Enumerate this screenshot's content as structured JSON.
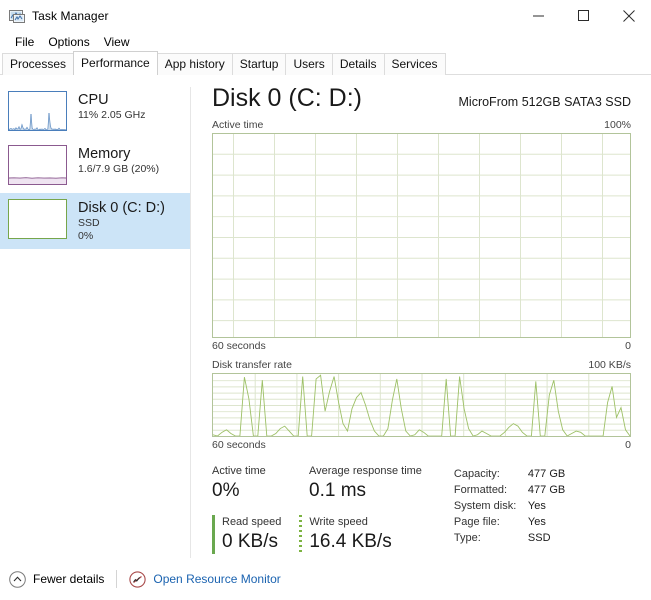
{
  "window": {
    "title": "Task Manager",
    "app_icon": "task-manager-icon",
    "controls": {
      "minimize": "minimize-icon",
      "maximize": "maximize-icon",
      "close": "close-icon"
    }
  },
  "menubar": {
    "items": [
      "File",
      "Options",
      "View"
    ]
  },
  "tabs": [
    {
      "label": "Processes",
      "active": false
    },
    {
      "label": "Performance",
      "active": true
    },
    {
      "label": "App history",
      "active": false
    },
    {
      "label": "Startup",
      "active": false
    },
    {
      "label": "Users",
      "active": false
    },
    {
      "label": "Details",
      "active": false
    },
    {
      "label": "Services",
      "active": false
    }
  ],
  "sidebar": {
    "items": [
      {
        "name": "CPU",
        "line1": "11%  2.05 GHz",
        "line2": "",
        "selected": false,
        "accent": "#4a7ebb",
        "fill": "#dce6f1"
      },
      {
        "name": "Memory",
        "line1": "1.6/7.9 GB (20%)",
        "line2": "",
        "selected": false,
        "accent": "#8b5a8f",
        "fill": "#f0e6f2"
      },
      {
        "name": "Disk 0 (C: D:)",
        "line1": "SSD",
        "line2": "0%",
        "selected": true,
        "accent": "#77a64b",
        "fill": "#ffffff"
      }
    ]
  },
  "main": {
    "title": "Disk 0 (C: D:)",
    "subtitle": "MicroFrom 512GB SATA3 SSD",
    "charts": [
      {
        "label": "Active time",
        "max_label": "100%",
        "left_foot": "60 seconds",
        "right_foot": "0"
      },
      {
        "label": "Disk transfer rate",
        "max_label": "100 KB/s",
        "left_foot": "60 seconds",
        "right_foot": "0"
      }
    ],
    "stats": {
      "active_time": {
        "label": "Active time",
        "value": "0%"
      },
      "avg_response": {
        "label": "Average response time",
        "value": "0.1 ms"
      },
      "read_speed": {
        "label": "Read speed",
        "value": "0 KB/s"
      },
      "write_speed": {
        "label": "Write speed",
        "value": "16.4 KB/s"
      },
      "details": [
        {
          "key": "Capacity:",
          "value": "477 GB"
        },
        {
          "key": "Formatted:",
          "value": "477 GB"
        },
        {
          "key": "System disk:",
          "value": "Yes"
        },
        {
          "key": "Page file:",
          "value": "Yes"
        },
        {
          "key": "Type:",
          "value": "SSD"
        }
      ]
    }
  },
  "footer": {
    "fewer_details": "Fewer details",
    "resource_monitor": "Open Resource Monitor"
  },
  "colors": {
    "chart_border": "#b2c49a",
    "chart_grid": "#d9e2c8",
    "chart_line": "#a8c97f",
    "selection": "#cce4f7",
    "link": "#1b63b0",
    "cpu_accent": "#4a7ebb",
    "memory_accent": "#8b5a8f",
    "disk_accent": "#77a64b"
  },
  "chart_data": {
    "type": "line",
    "title": "Disk transfer rate",
    "ylabel": "KB/s",
    "xlabel": "60 seconds",
    "ylim": [
      0,
      100
    ],
    "values": [
      2,
      0,
      6,
      10,
      4,
      0,
      0,
      95,
      60,
      0,
      0,
      90,
      0,
      0,
      4,
      12,
      16,
      8,
      0,
      0,
      96,
      0,
      0,
      92,
      98,
      40,
      72,
      96,
      55,
      20,
      8,
      44,
      62,
      70,
      50,
      26,
      8,
      0,
      0,
      12,
      58,
      92,
      44,
      8,
      0,
      2,
      10,
      6,
      0,
      0,
      0,
      0,
      92,
      0,
      0,
      96,
      44,
      12,
      0,
      2,
      8,
      4,
      0,
      0,
      0,
      6,
      14,
      20,
      16,
      6,
      0,
      0,
      88,
      0,
      0,
      66,
      90,
      40,
      10,
      0,
      4,
      8,
      6,
      0,
      0,
      0,
      0,
      0,
      54,
      80,
      30,
      46,
      10,
      0
    ]
  },
  "active_time_chart": {
    "type": "area",
    "title": "Active time",
    "ylim": [
      0,
      100
    ],
    "values": [
      0,
      0,
      0,
      0,
      0,
      0,
      0,
      0,
      0,
      0,
      0,
      0,
      0,
      0,
      0,
      0,
      0,
      0,
      0,
      0,
      0,
      0,
      0,
      0,
      0,
      0,
      0,
      0,
      0,
      0
    ]
  },
  "cpu_mini_chart": {
    "type": "area",
    "values": [
      2,
      4,
      3,
      6,
      2,
      3,
      8,
      4,
      22,
      6,
      3,
      4,
      9,
      5,
      3,
      2,
      5,
      12,
      4,
      3,
      2,
      6,
      3,
      2,
      4,
      3,
      5,
      2,
      3,
      28,
      8,
      4,
      3,
      6,
      4,
      3,
      2,
      5,
      3,
      2
    ]
  },
  "memory_mini_chart": {
    "type": "area",
    "values": [
      20,
      20,
      20,
      20,
      20,
      20,
      20,
      21,
      20,
      20,
      20,
      20,
      20,
      20,
      20,
      20,
      20,
      20,
      20,
      20
    ]
  }
}
